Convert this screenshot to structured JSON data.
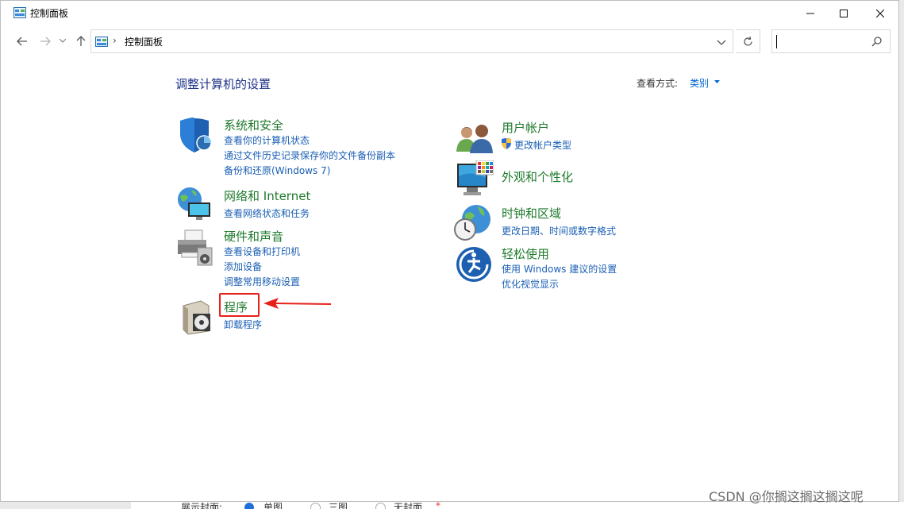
{
  "window": {
    "title": "控制面板"
  },
  "nav": {
    "breadcrumb_sep": "›",
    "address": "控制面板",
    "search_placeholder": ""
  },
  "main": {
    "heading": "调整计算机的设置",
    "view_by_label": "查看方式:",
    "view_by_value": "类别"
  },
  "categories_left": [
    {
      "title": "系统和安全",
      "links": [
        "查看你的计算机状态",
        "通过文件历史记录保存你的文件备份副本",
        "备份和还原(Windows 7)"
      ]
    },
    {
      "title": "网络和 Internet",
      "links": [
        "查看网络状态和任务"
      ]
    },
    {
      "title": "硬件和声音",
      "links": [
        "查看设备和打印机",
        "添加设备",
        "调整常用移动设置"
      ]
    },
    {
      "title": "程序",
      "links": [
        "卸载程序"
      ]
    }
  ],
  "categories_right": [
    {
      "title": "用户帐户",
      "links": [
        "更改帐户类型"
      ]
    },
    {
      "title": "外观和个性化",
      "links": []
    },
    {
      "title": "时钟和区域",
      "links": [
        "更改日期、时间或数字格式"
      ]
    },
    {
      "title": "轻松使用",
      "links": [
        "使用 Windows 建议的设置",
        "优化视觉显示"
      ]
    }
  ],
  "strip": {
    "label": "展示封面:",
    "opt1": "单图",
    "opt2": "三图",
    "opt3": "无封面",
    "required": "*"
  },
  "watermark": "CSDN @你搁这搁这搁这呢",
  "colors": {
    "title_green": "#1e7a2c",
    "link_blue": "#1a5fb4",
    "heading_blue": "#1e3287",
    "annotation_red": "#e8201a"
  }
}
